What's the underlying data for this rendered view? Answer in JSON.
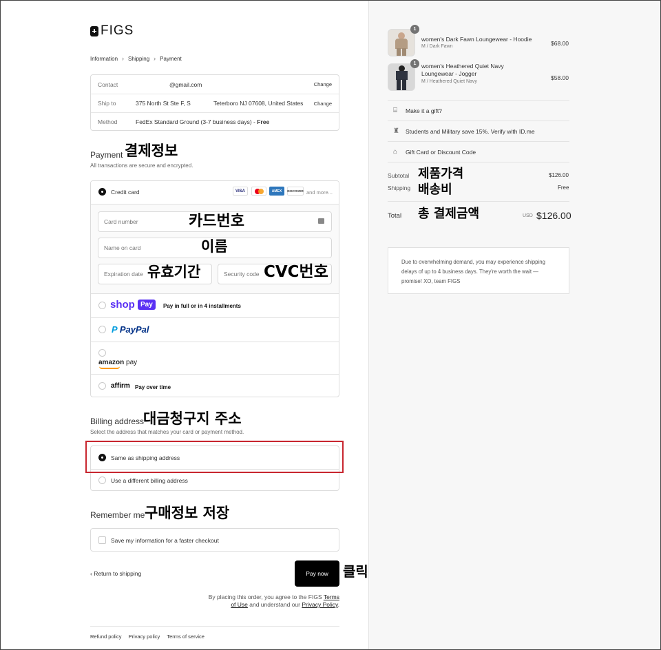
{
  "brand": {
    "name": "FIGS"
  },
  "breadcrumb": [
    "Information",
    "Shipping",
    "Payment"
  ],
  "info": {
    "contact": {
      "label": "Contact",
      "value": "@gmail.com",
      "action": "Change"
    },
    "ship_to": {
      "label": "Ship to",
      "value_street": "375 North St Ste F, S",
      "value_city": "Teterboro NJ 07608, United States",
      "action": "Change"
    },
    "method": {
      "label": "Method",
      "value": "FedEx Standard Ground (3-7 business days) - ",
      "price": "Free"
    }
  },
  "payment": {
    "title": "Payment",
    "subtitle": "All transactions are secure and encrypted.",
    "credit_card_label": "Credit card",
    "card_brands": [
      "VISA",
      "MC",
      "AMEX",
      "DISCOVER"
    ],
    "and_more": "and more...",
    "fields": {
      "card_number": "Card number",
      "name_on_card": "Name on card",
      "expiration": "Expiration date",
      "security": "Security code"
    },
    "shop_pay": {
      "logo_text": "shop",
      "badge": "Pay",
      "text": "Pay in full or in 4 installments"
    },
    "paypal": "PayPal",
    "amazon": {
      "a": "amazon",
      "b": "pay"
    },
    "affirm": {
      "logo": "affirm",
      "text": "Pay over time"
    }
  },
  "billing": {
    "title": "Billing address",
    "subtitle": "Select the address that matches your card or payment method.",
    "options": [
      "Same as shipping address",
      "Use a different billing address"
    ]
  },
  "remember": {
    "title": "Remember me",
    "checkbox": "Save my information for a faster checkout"
  },
  "actions": {
    "return": "Return to shipping",
    "pay_now": "Pay now"
  },
  "legal": {
    "prefix": "By placing this order, you agree to the FIGS ",
    "terms_a": "Terms",
    "terms_b": "of Use",
    "middle": " and understand our ",
    "privacy": "Privacy Policy",
    "suffix": "."
  },
  "footer_links": [
    "Refund policy",
    "Privacy policy",
    "Terms of service"
  ],
  "order": {
    "items": [
      {
        "qty": "1",
        "name": "women's Dark Fawn Loungewear - Hoodie",
        "variant": "M / Dark Fawn",
        "price": "$68.00"
      },
      {
        "qty": "1",
        "name_line1": "women's Heathered Quiet Navy",
        "name_line2": "Loungewear - Jogger",
        "variant": "M / Heathered Quiet Navy",
        "price": "$58.00"
      }
    ],
    "gift": "Make it a gift?",
    "military": "Students and Military save 15%. Verify with ID.me",
    "discount": "Gift Card or Discount Code",
    "subtotal_label": "Subtotal",
    "subtotal": "$126.00",
    "shipping_label": "Shipping",
    "shipping": "Free",
    "total_label": "Total",
    "currency": "USD",
    "total": "$126.00",
    "notice": "Due to overwhelming demand, you may experience shipping delays of up to 4 business days. They're worth the wait — promise! XO, team FIGS"
  },
  "annotations": {
    "payment_info": "결제정보",
    "card_number": "카드번호",
    "name": "이름",
    "expiry": "유효기간",
    "cvc": "CVC번호",
    "billing": "대금청구지 주소",
    "remember": "구매정보 저장",
    "click": "클릭",
    "product_price": "제품가격",
    "shipping_fee": "배송비",
    "total": "총 결제금액"
  },
  "colors": {
    "highlight": "#c8262f",
    "shop_pay": "#5a31f4",
    "paypal_dark": "#003087",
    "paypal_light": "#009cde"
  }
}
